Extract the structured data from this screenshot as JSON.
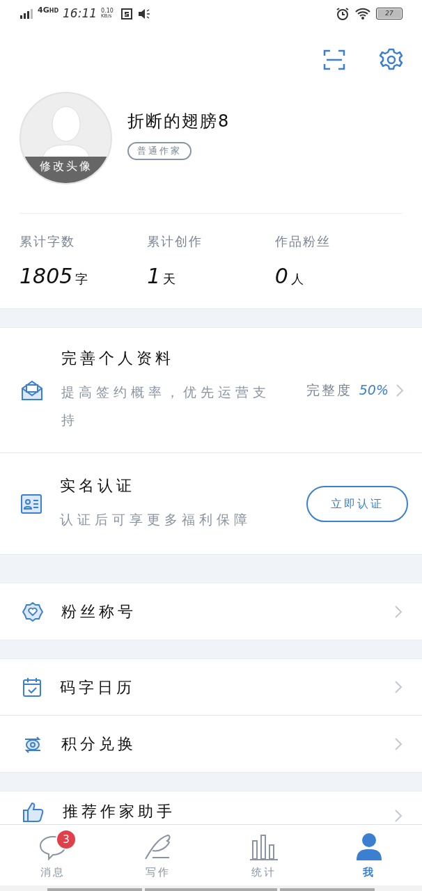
{
  "status_bar": {
    "network": "4G",
    "network_sub": "HD",
    "time": "16:11",
    "speed_value": "0.10",
    "speed_unit": "KB/s",
    "battery": "27"
  },
  "profile": {
    "avatar_caption": "修改头像",
    "name": "折断的翅膀8",
    "badge": "普通作家"
  },
  "stats": [
    {
      "label": "累计字数",
      "value": "1805",
      "unit": "字"
    },
    {
      "label": "累计创作",
      "value": "1",
      "unit": "天"
    },
    {
      "label": "作品粉丝",
      "value": "0",
      "unit": "人"
    }
  ],
  "cards": [
    {
      "kind": "progress",
      "title": "完善个人资料",
      "subtitle": "提高签约概率，优先运营支持",
      "progress_label": "完整度",
      "progress_value": "50%"
    },
    {
      "kind": "action",
      "title": "实名认证",
      "subtitle": "认证后可享更多福利保障",
      "button": "立即认证"
    }
  ],
  "menu_groups": [
    [
      {
        "label": "粉丝称号"
      }
    ],
    [
      {
        "label": "码字日历"
      },
      {
        "label": "积分兑换"
      }
    ],
    [
      {
        "label": "推荐作家助手"
      }
    ]
  ],
  "tabs": [
    {
      "label": "消息",
      "badge": "3",
      "selected": false
    },
    {
      "label": "写作",
      "selected": false
    },
    {
      "label": "统计",
      "selected": false
    },
    {
      "label": "我",
      "selected": true
    }
  ]
}
